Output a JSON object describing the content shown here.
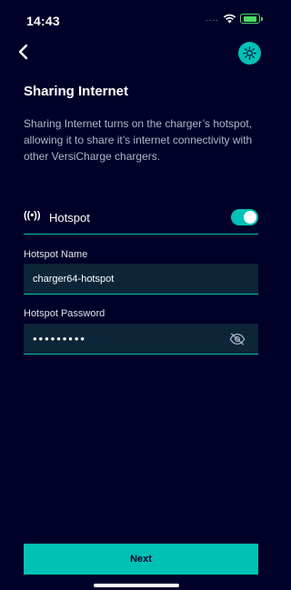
{
  "status_bar": {
    "time": "14:43",
    "signal": "....",
    "icons": [
      "wifi-icon",
      "battery-charging-icon"
    ]
  },
  "header": {
    "back_icon": "chevron-left-icon",
    "theme_icon": "sun-icon"
  },
  "page": {
    "title": "Sharing Internet",
    "description": "Sharing Internet turns on the charger’s hotspot, allowing it to share it’s internet connectivity with other VersiCharge chargers."
  },
  "hotspot": {
    "icon_glyph": "((•))",
    "label": "Hotspot",
    "enabled": true
  },
  "fields": {
    "name_label": "Hotspot Name",
    "name_value": "charger64-hotspot",
    "password_label": "Hotspot Password",
    "password_value": "•••••••••",
    "password_icon": "eye-off-icon"
  },
  "footer": {
    "next_label": "Next"
  },
  "colors": {
    "background": "#000028",
    "accent": "#00c1b6",
    "field_bg": "#0d2538"
  }
}
